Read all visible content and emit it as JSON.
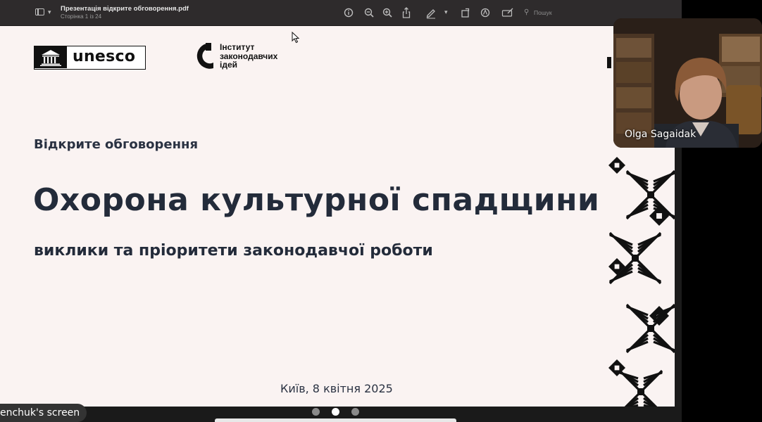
{
  "window": {
    "document_title": "Презентація відкрите обговорення.pdf",
    "page_status": "Сторінка 1 із 24"
  },
  "toolbar": {
    "icons": [
      "sidebar-icon",
      "chevron-down-icon",
      "info-icon",
      "zoom-out-icon",
      "zoom-in-icon",
      "share-icon",
      "markup-pen-icon",
      "chevron-down-icon",
      "rotate-icon",
      "markup-circle-icon",
      "annotate-icon"
    ],
    "search_placeholder": "Пошук"
  },
  "slide": {
    "logo_unesco": "unesco",
    "logo_institute": "Інститут законодавчих ідей",
    "kicker": "Відкрите обговорення",
    "title": "Охорона культурної спадщини",
    "subtitle": "виклики та пріоритети законодавчої роботи",
    "date": "Київ, 8 квітня 2025"
  },
  "meeting": {
    "screen_owner_label": "enchuk's screen",
    "participant_name": "Olga Sagaidak",
    "pages": {
      "count": 3,
      "active": 2
    }
  },
  "colors": {
    "slide_background": "#faf3f2",
    "title_text": "#232b3a",
    "toolbar": "#2e2b2c",
    "ornament": "#111111"
  }
}
